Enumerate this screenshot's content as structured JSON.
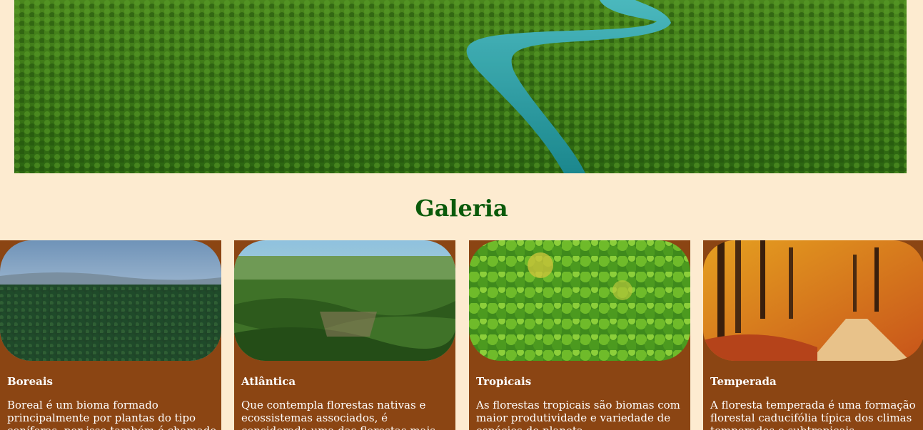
{
  "hero": {
    "image_description": "aerial-forest-river-photo"
  },
  "gallery": {
    "title": "Galeria",
    "cards": [
      {
        "title": "Boreais",
        "text": "Boreal é um bioma formado principalmente por plantas do tipo coníferas, por isso também é chamado de Floresta de Coníferas."
      },
      {
        "title": "Atlântica",
        "text": "Que contempla florestas nativas e ecossistemas associados, é considerada uma das florestas mais antigas do Brasil."
      },
      {
        "title": "Tropicais",
        "text": "As florestas tropicais são biomas com maior produtividade e variedade de espécies do planeta."
      },
      {
        "title": "Temperada",
        "text": "A floresta temperada é uma formação florestal caducifólia típica dos climas temperados e subtropicais."
      }
    ]
  },
  "colors": {
    "background": "#fdebd0",
    "title": "#0a5a0a",
    "card": "#8b4513"
  }
}
